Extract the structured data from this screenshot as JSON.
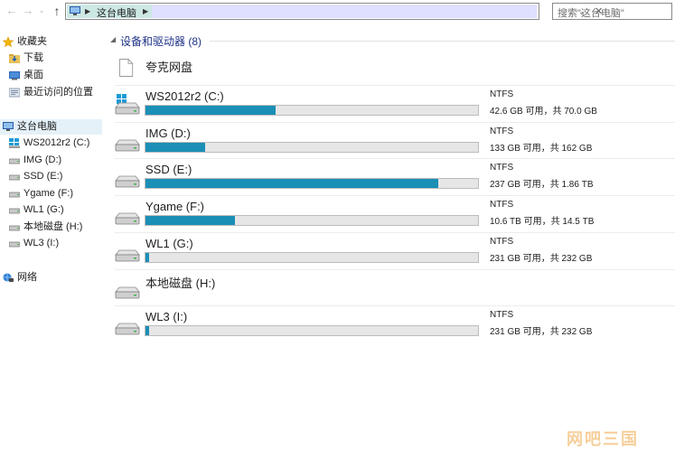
{
  "toolbar": {
    "back_icon": "←",
    "forward_icon": "→",
    "history_icon": "⌄",
    "up_icon": "↑"
  },
  "address": {
    "segment": "这台电脑",
    "placeholder": "搜索\"这台电脑\""
  },
  "sidebar": {
    "favorites": "收藏夹",
    "downloads": "下载",
    "desktop": "桌面",
    "recent": "最近访问的位置",
    "this_pc": "这台电脑",
    "drives": [
      "WS2012r2 (C:)",
      "IMG (D:)",
      "SSD (E:)",
      "Ygame (F:)",
      "WL1 (G:)",
      "本地磁盘 (H:)",
      "WL3 (I:)"
    ],
    "network": "网络"
  },
  "main": {
    "group_title": "设备和驱动器 (8)",
    "cloud": "夸克网盘",
    "drives": [
      {
        "name": "WS2012r2 (C:)",
        "fs": "NTFS",
        "space": "42.6 GB 可用，共 70.0 GB",
        "used_fraction": 0.39
      },
      {
        "name": "IMG (D:)",
        "fs": "NTFS",
        "space": "133 GB 可用，共 162 GB",
        "used_fraction": 0.18
      },
      {
        "name": "SSD (E:)",
        "fs": "NTFS",
        "space": "237 GB 可用，共 1.86 TB",
        "used_fraction": 0.88
      },
      {
        "name": "Ygame (F:)",
        "fs": "NTFS",
        "space": "10.6 TB 可用，共 14.5 TB",
        "used_fraction": 0.27
      },
      {
        "name": "WL1 (G:)",
        "fs": "NTFS",
        "space": "231 GB 可用，共 232 GB",
        "used_fraction": 0.01
      },
      {
        "name": "本地磁盘 (H:)",
        "fs": "",
        "space": "",
        "used_fraction": null
      },
      {
        "name": "WL3 (I:)",
        "fs": "NTFS",
        "space": "231 GB 可用，共 232 GB",
        "used_fraction": 0.01
      }
    ]
  },
  "watermark": "网吧三国",
  "colors": {
    "bar_fill": "#1b8fb6",
    "selection": "#e5f1f8",
    "group_title": "#1e3287"
  }
}
